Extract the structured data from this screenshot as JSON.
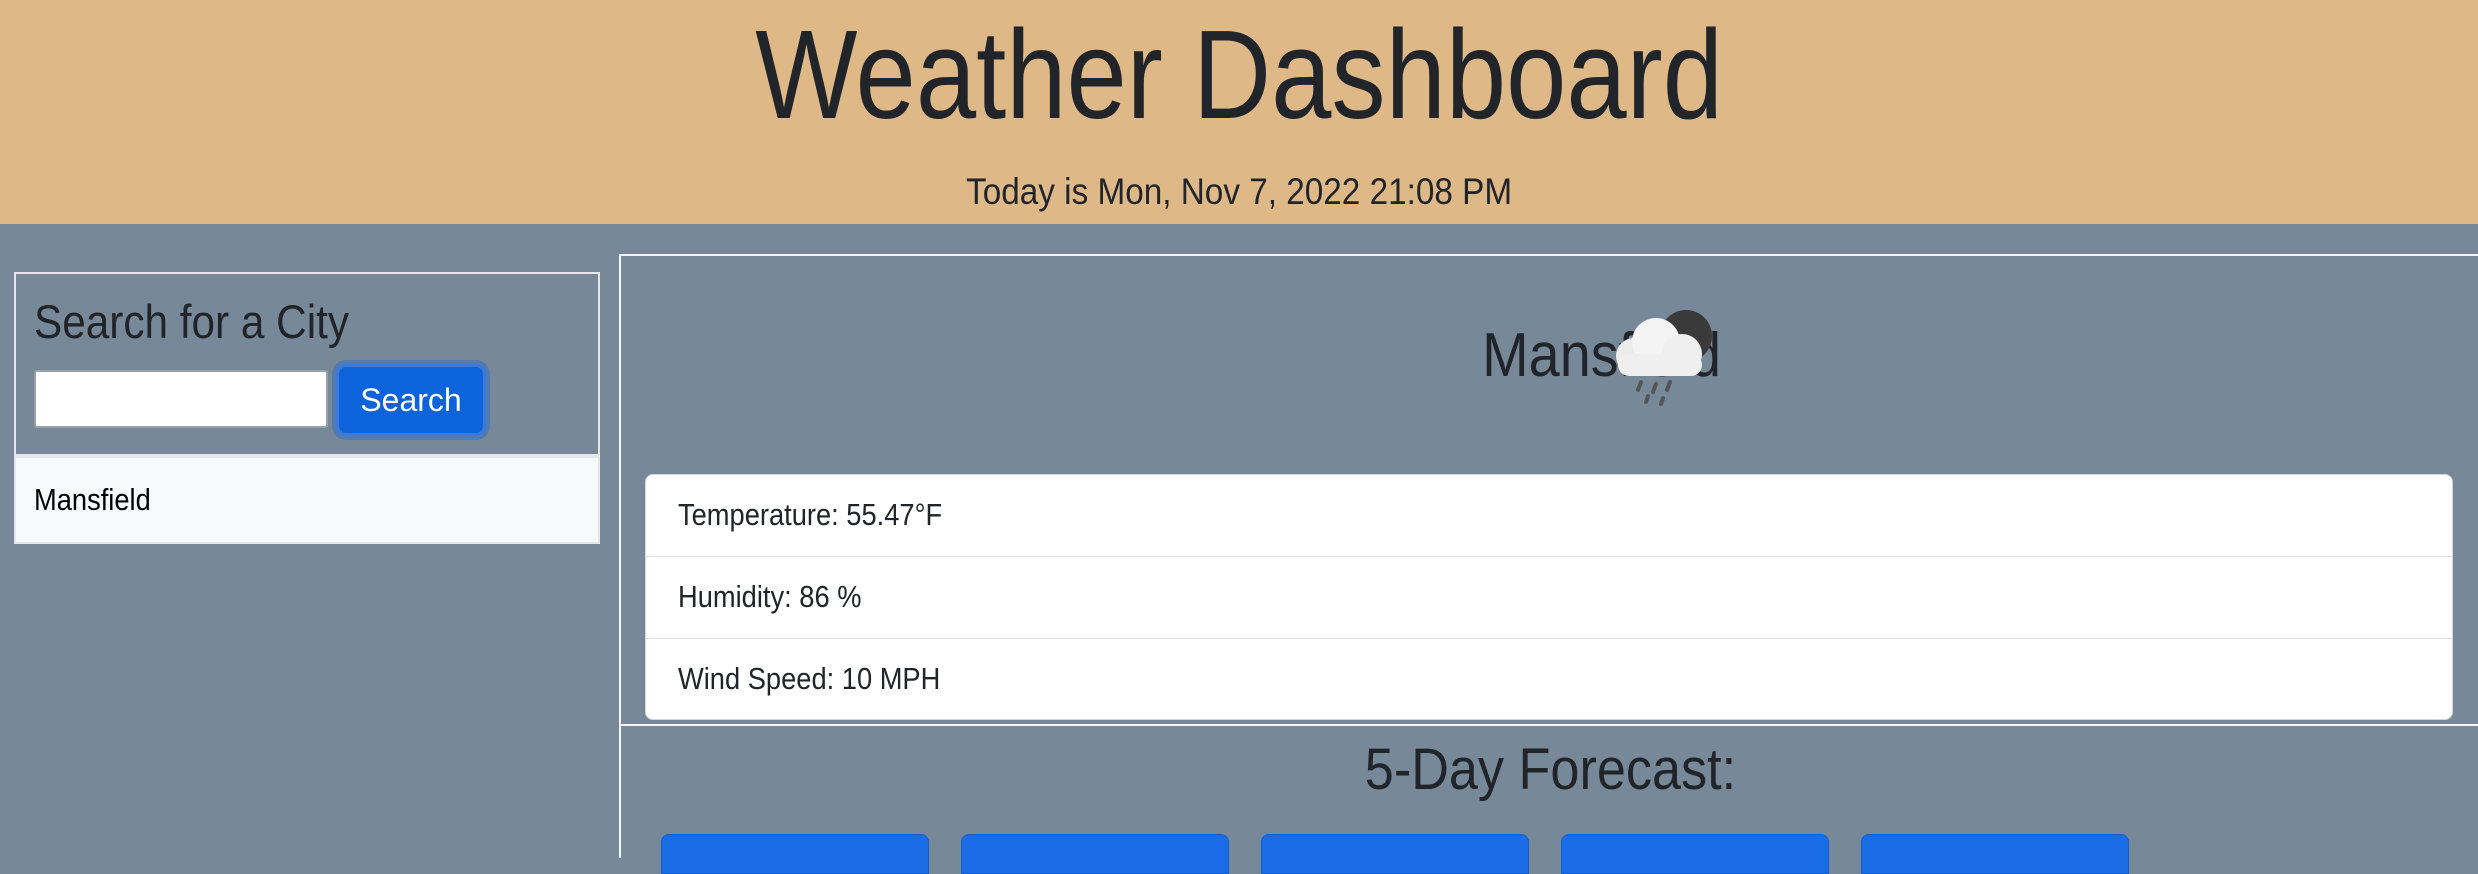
{
  "header": {
    "title": "Weather Dashboard",
    "date_text": "Today is Mon, Nov 7, 2022 21:08 PM"
  },
  "search": {
    "title": "Search for a City",
    "input_value": "",
    "button_label": "Search"
  },
  "history": {
    "items": [
      {
        "label": "Mansfield"
      }
    ]
  },
  "current": {
    "city": "Mansfield",
    "icon": "cloud-rain-night-icon",
    "details": [
      {
        "label": "Temperature: 55.47°F"
      },
      {
        "label": "Humidity: 86 %"
      },
      {
        "label": "Wind Speed: 10 MPH"
      }
    ]
  },
  "forecast": {
    "title": "5-Day Forecast:",
    "cards": [
      {},
      {},
      {},
      {},
      {}
    ]
  },
  "colors": {
    "header_bg": "#deb887",
    "page_bg": "#778899",
    "button_bg": "#0d63d9",
    "card_bg": "#1a6de6"
  }
}
